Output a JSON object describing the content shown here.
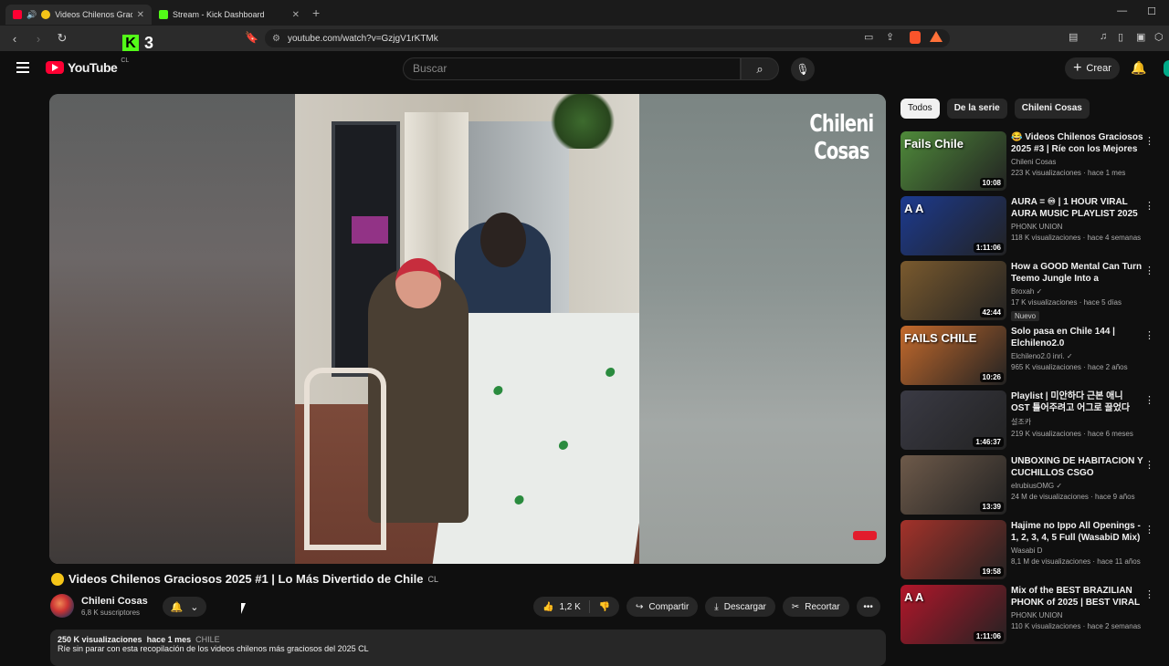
{
  "browser": {
    "tabs": [
      {
        "label": "Videos Chilenos Graciosos"
      },
      {
        "label": "Stream - Kick Dashboard"
      }
    ],
    "url": "youtube.com/watch?v=GzjgV1rKTMk",
    "kick_count": "3"
  },
  "header": {
    "logo_text": "YouTube",
    "country_code": "CL",
    "search_placeholder": "Buscar",
    "create_label": "Crear"
  },
  "player": {
    "watermark_line1": "Chileni",
    "watermark_line2": "Cosas"
  },
  "video": {
    "title": "Videos Chilenos Graciosos 2025 #1 | Lo Más Divertido de Chile",
    "title_flag": "CL",
    "channel": "Chileni Cosas",
    "subscribers": "6,8 K suscriptores",
    "likes": "1,2 K",
    "share_label": "Compartir",
    "download_label": "Descargar",
    "clip_label": "Recortar",
    "views": "250 K visualizaciones",
    "age": "hace 1 mes",
    "tag": "CHILE",
    "description": "Ríe sin parar con esta recopilación de los videos chilenos más graciosos del 2025 CL"
  },
  "sidebar": {
    "chips": [
      "Todos",
      "De la serie",
      "Chileni Cosas"
    ],
    "recommendations": [
      {
        "title": "😂 Videos Chilenos Graciosos 2025 #3 | Ríe con los Mejores ...",
        "channel": "Chileni Cosas",
        "meta": "223 K visualizaciones · hace 1 mes",
        "duration": "10:08",
        "thumb_color": "#4f8a3a",
        "thumb_text": "Fails Chile"
      },
      {
        "title": "AURA = ♾ | 1 HOUR VIRAL AURA MUSIC PLAYLIST 2025 ...",
        "channel": "PHONK UNION",
        "meta": "118 K visualizaciones · hace 4 semanas",
        "duration": "1:11:06",
        "thumb_color": "#1c3a8f",
        "thumb_text": "A A"
      },
      {
        "title": "How a GOOD Mental Can Turn Teemo Jungle Into a WINNING...",
        "channel": "Broxah ✓",
        "meta": "17 K visualizaciones · hace 5 días",
        "duration": "42:44",
        "thumb_color": "#7a5a2e",
        "thumb_text": "",
        "badge": "Nuevo"
      },
      {
        "title": "Solo pasa en Chile 144 | Elchileno2.0",
        "channel": "Elchileno2.0 inri. ✓",
        "meta": "965 K visualizaciones · hace 2 años",
        "duration": "10:26",
        "thumb_color": "#c46a2c",
        "thumb_text": "FAILS CHILE"
      },
      {
        "title": "Playlist | 미안하다 근본 애니 OST 틀어주려고 어그로 끌었다",
        "channel": "설조카",
        "meta": "219 K visualizaciones · hace 6 meses",
        "duration": "1:46:37",
        "thumb_color": "#3a3a44",
        "thumb_text": ""
      },
      {
        "title": "UNBOXING DE HABITACION Y CUCHILLOS CSGO",
        "channel": "elrubiusOMG ✓",
        "meta": "24 M de visualizaciones · hace 9 años",
        "duration": "13:39",
        "thumb_color": "#6e5a4a",
        "thumb_text": ""
      },
      {
        "title": "Hajime no Ippo All Openings - 1, 2, 3, 4, 5 Full (WasabiD Mix)",
        "channel": "Wasabi D",
        "meta": "8,1 M de visualizaciones · hace 11 años",
        "duration": "19:58",
        "thumb_color": "#a4322a",
        "thumb_text": ""
      },
      {
        "title": "Mix of the BEST BRAZILIAN PHONK of 2025 | BEST VIRAL ...",
        "channel": "PHONK UNION",
        "meta": "110 K visualizaciones · hace 2 semanas",
        "duration": "1:11:06",
        "thumb_color": "#b3162a",
        "thumb_text": "A A"
      }
    ]
  }
}
